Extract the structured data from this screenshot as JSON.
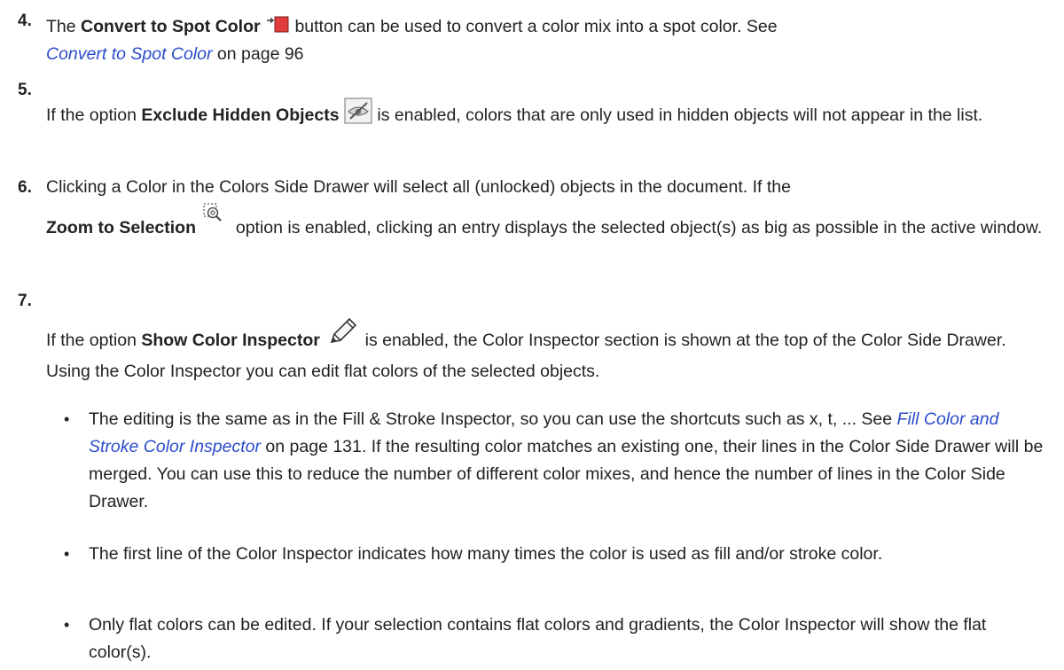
{
  "items": [
    {
      "number": "4.",
      "before": "The ",
      "strong": "Convert to Spot Color",
      "after": " button can be used to convert a color mix into a spot color. See",
      "link": "Convert to Spot Color",
      "link_after": " on page 96"
    },
    {
      "number": "5.",
      "before": "If the option ",
      "strong": "Exclude Hidden Objects",
      "after": " is enabled, colors that are only used in hidden objects will not appear in the list."
    },
    {
      "number": "6.",
      "line1": "Clicking a Color in the Colors Side Drawer will select all (unlocked) objects in the document. If the",
      "strong": "Zoom to Selection",
      "after": " option is enabled, clicking an entry displays the selected object(s) as big as possible in the active window."
    },
    {
      "number": "7.",
      "before": "If the option ",
      "strong": "Show Color Inspector",
      "after": " is enabled, the Color Inspector section is shown at the top of the Color Side Drawer. Using the Color Inspector you can edit flat colors of the selected objects."
    }
  ],
  "bullets": [
    {
      "marker": "•",
      "before": "The editing is the same as in the Fill & Stroke Inspector, so you can use the shortcuts such as x, t, ... See ",
      "link": "Fill Color and Stroke Color Inspector",
      "after": " on page 131. If the resulting color matches an existing one, their lines in the Color Side Drawer will be merged. You can use this to reduce the number of different color mixes, and hence the number of lines in the Color Side Drawer."
    },
    {
      "marker": "•",
      "text": "The first line of the Color Inspector indicates how many times the color is used as fill and/or stroke color."
    },
    {
      "marker": "•",
      "text": "Only flat colors can be edited. If your selection contains flat colors and gradients, the Color Inspector will show the flat color(s)."
    }
  ],
  "icons": {
    "convert_spot": "convert-to-spot-color-icon",
    "exclude_hidden": "exclude-hidden-objects-icon",
    "zoom_selection": "zoom-to-selection-icon",
    "show_inspector": "pencil-icon"
  },
  "colors": {
    "link": "#2b4cc9",
    "spot_red": "#e03c3c",
    "text": "#222222"
  }
}
